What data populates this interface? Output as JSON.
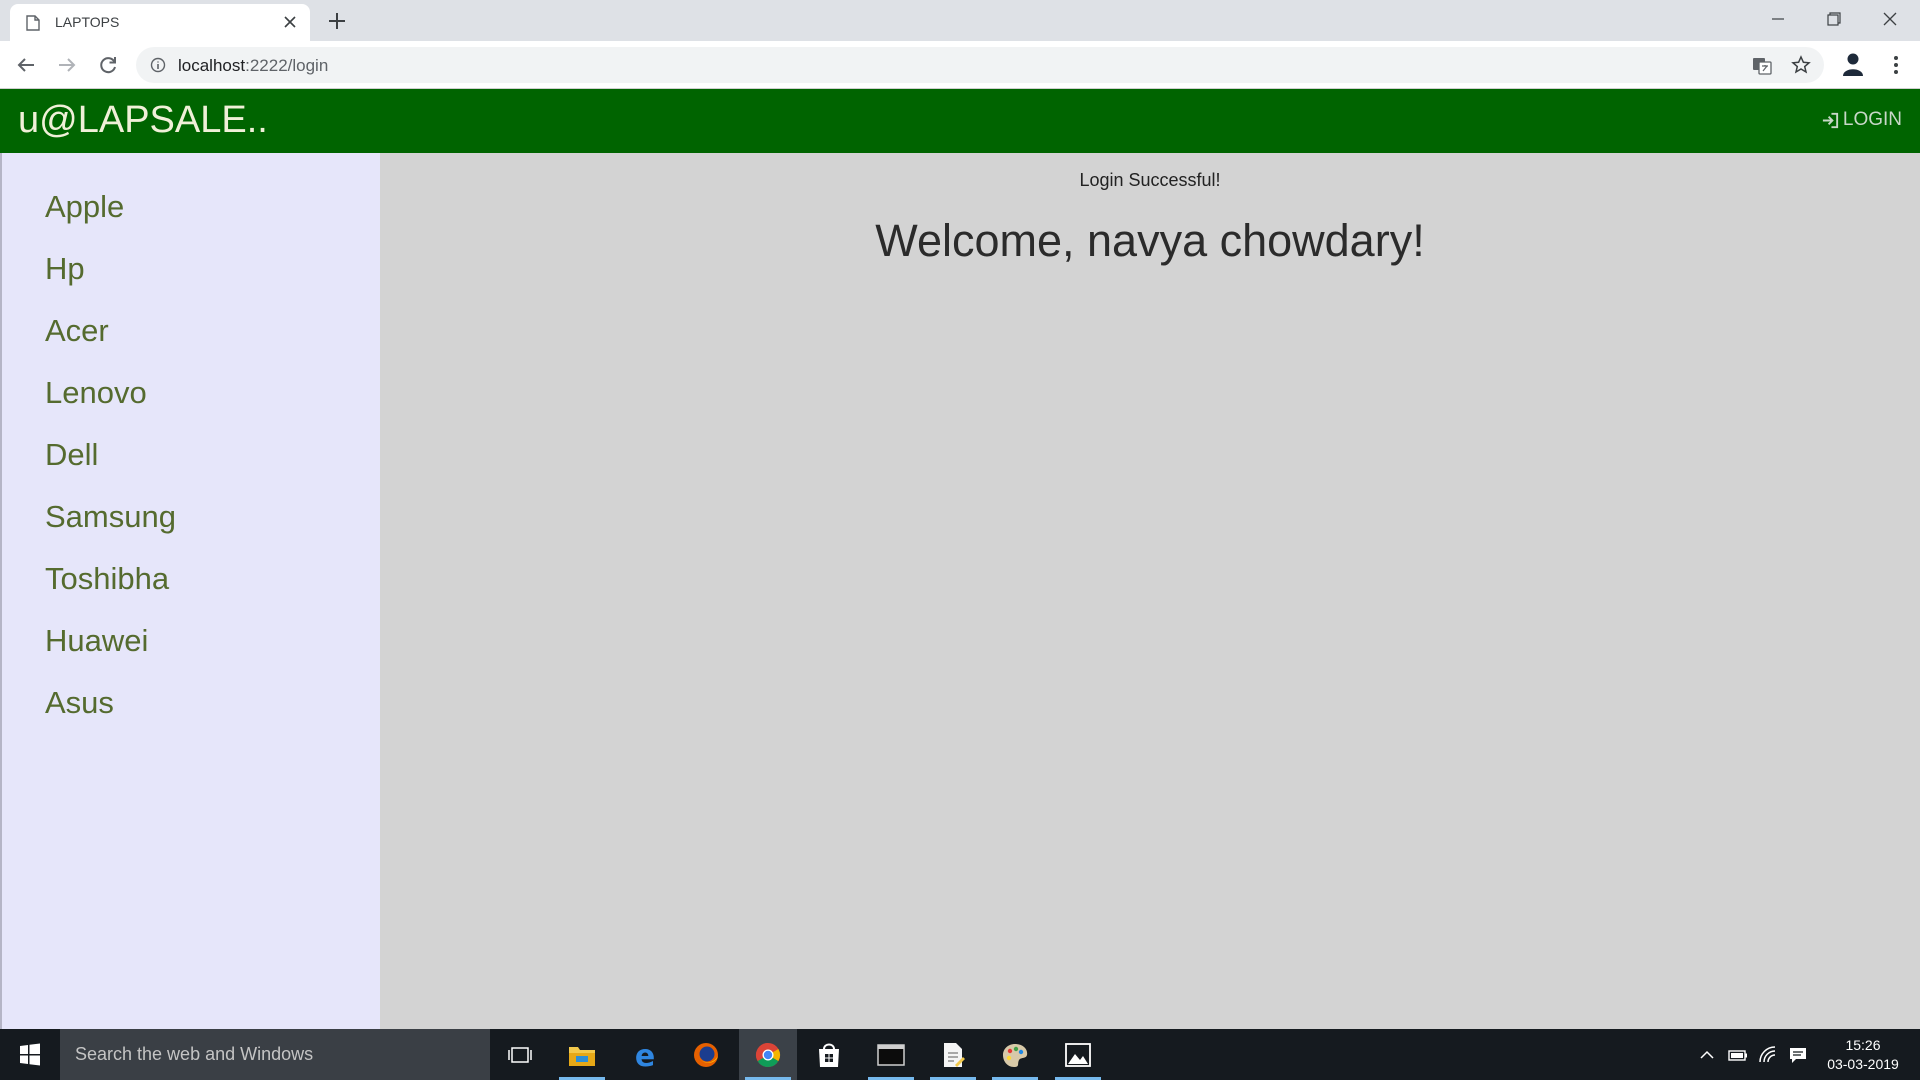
{
  "browser": {
    "tab_title": "LAPTOPS",
    "url_host": "localhost",
    "url_path": ":2222/login"
  },
  "app": {
    "brand": "u@LAPSALE..",
    "login_label": "LOGIN",
    "theme_color": "#006400"
  },
  "sidebar": {
    "items": [
      "Apple",
      "Hp",
      "Acer",
      "Lenovo",
      "Dell",
      "Samsung",
      "Toshibha",
      "Huawei",
      "Asus"
    ]
  },
  "main": {
    "flash_message": "Login Successful!",
    "welcome": "Welcome, navya chowdary!"
  },
  "taskbar": {
    "search_placeholder": "Search the web and Windows",
    "time": "15:26",
    "date": "03-03-2019",
    "apps": [
      "task-view",
      "file-explorer",
      "edge",
      "firefox",
      "chrome",
      "store",
      "terminal",
      "document",
      "paint",
      "photos"
    ]
  }
}
